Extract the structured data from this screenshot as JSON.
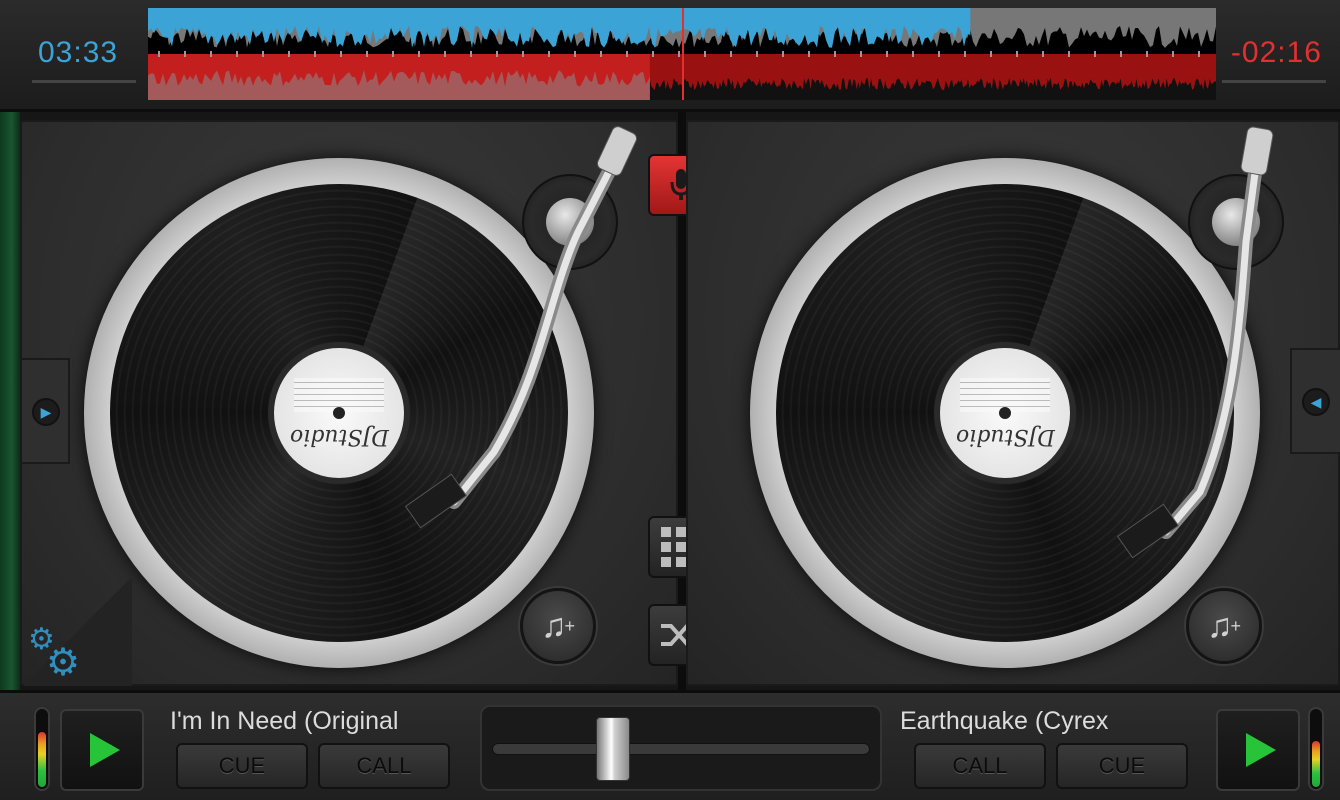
{
  "time": {
    "elapsed": "03:33",
    "remaining": "-02:16"
  },
  "colors": {
    "deck_a_wave": "#3ca3d6",
    "deck_b_wave": "#c41f1f",
    "play": "#27c43a",
    "mic": "#e43434"
  },
  "progress": {
    "deck_a": 0.77,
    "deck_b": 0.47
  },
  "deck_a": {
    "label_brand": "DJStudio",
    "track_title": "I'm In Need (Original",
    "buttons": {
      "cue": "CUE",
      "call": "CALL"
    },
    "add_music_icon": "music-add-icon",
    "level": 0.72
  },
  "deck_b": {
    "label_brand": "DJStudio",
    "track_title": "Earthquake (Cyrex",
    "buttons": {
      "call": "CALL",
      "cue": "CUE"
    },
    "add_music_icon": "music-add-icon",
    "level": 0.6
  },
  "center": {
    "mic_icon": "microphone-icon",
    "grid_icon": "grid-icon",
    "shuffle_icon": "shuffle-icon"
  },
  "crossfader": {
    "position": 0.3
  },
  "settings_icon": "gears-icon",
  "icons": {
    "left_arrow": "▶",
    "right_arrow": "◀"
  }
}
